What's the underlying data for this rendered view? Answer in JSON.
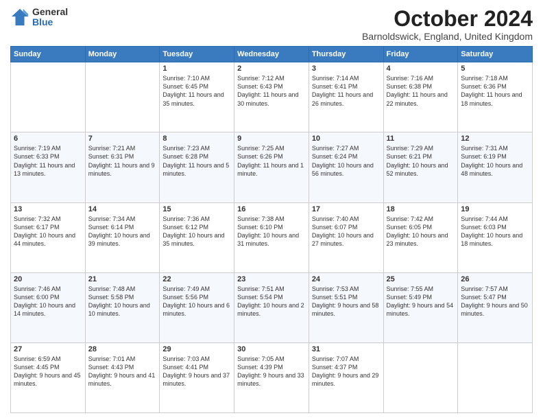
{
  "logo": {
    "general": "General",
    "blue": "Blue"
  },
  "header": {
    "month": "October 2024",
    "location": "Barnoldswick, England, United Kingdom"
  },
  "days": [
    "Sunday",
    "Monday",
    "Tuesday",
    "Wednesday",
    "Thursday",
    "Friday",
    "Saturday"
  ],
  "weeks": [
    [
      {
        "day": "",
        "content": ""
      },
      {
        "day": "",
        "content": ""
      },
      {
        "day": "1",
        "content": "Sunrise: 7:10 AM\nSunset: 6:45 PM\nDaylight: 11 hours and 35 minutes."
      },
      {
        "day": "2",
        "content": "Sunrise: 7:12 AM\nSunset: 6:43 PM\nDaylight: 11 hours and 30 minutes."
      },
      {
        "day": "3",
        "content": "Sunrise: 7:14 AM\nSunset: 6:41 PM\nDaylight: 11 hours and 26 minutes."
      },
      {
        "day": "4",
        "content": "Sunrise: 7:16 AM\nSunset: 6:38 PM\nDaylight: 11 hours and 22 minutes."
      },
      {
        "day": "5",
        "content": "Sunrise: 7:18 AM\nSunset: 6:36 PM\nDaylight: 11 hours and 18 minutes."
      }
    ],
    [
      {
        "day": "6",
        "content": "Sunrise: 7:19 AM\nSunset: 6:33 PM\nDaylight: 11 hours and 13 minutes."
      },
      {
        "day": "7",
        "content": "Sunrise: 7:21 AM\nSunset: 6:31 PM\nDaylight: 11 hours and 9 minutes."
      },
      {
        "day": "8",
        "content": "Sunrise: 7:23 AM\nSunset: 6:28 PM\nDaylight: 11 hours and 5 minutes."
      },
      {
        "day": "9",
        "content": "Sunrise: 7:25 AM\nSunset: 6:26 PM\nDaylight: 11 hours and 1 minute."
      },
      {
        "day": "10",
        "content": "Sunrise: 7:27 AM\nSunset: 6:24 PM\nDaylight: 10 hours and 56 minutes."
      },
      {
        "day": "11",
        "content": "Sunrise: 7:29 AM\nSunset: 6:21 PM\nDaylight: 10 hours and 52 minutes."
      },
      {
        "day": "12",
        "content": "Sunrise: 7:31 AM\nSunset: 6:19 PM\nDaylight: 10 hours and 48 minutes."
      }
    ],
    [
      {
        "day": "13",
        "content": "Sunrise: 7:32 AM\nSunset: 6:17 PM\nDaylight: 10 hours and 44 minutes."
      },
      {
        "day": "14",
        "content": "Sunrise: 7:34 AM\nSunset: 6:14 PM\nDaylight: 10 hours and 39 minutes."
      },
      {
        "day": "15",
        "content": "Sunrise: 7:36 AM\nSunset: 6:12 PM\nDaylight: 10 hours and 35 minutes."
      },
      {
        "day": "16",
        "content": "Sunrise: 7:38 AM\nSunset: 6:10 PM\nDaylight: 10 hours and 31 minutes."
      },
      {
        "day": "17",
        "content": "Sunrise: 7:40 AM\nSunset: 6:07 PM\nDaylight: 10 hours and 27 minutes."
      },
      {
        "day": "18",
        "content": "Sunrise: 7:42 AM\nSunset: 6:05 PM\nDaylight: 10 hours and 23 minutes."
      },
      {
        "day": "19",
        "content": "Sunrise: 7:44 AM\nSunset: 6:03 PM\nDaylight: 10 hours and 18 minutes."
      }
    ],
    [
      {
        "day": "20",
        "content": "Sunrise: 7:46 AM\nSunset: 6:00 PM\nDaylight: 10 hours and 14 minutes."
      },
      {
        "day": "21",
        "content": "Sunrise: 7:48 AM\nSunset: 5:58 PM\nDaylight: 10 hours and 10 minutes."
      },
      {
        "day": "22",
        "content": "Sunrise: 7:49 AM\nSunset: 5:56 PM\nDaylight: 10 hours and 6 minutes."
      },
      {
        "day": "23",
        "content": "Sunrise: 7:51 AM\nSunset: 5:54 PM\nDaylight: 10 hours and 2 minutes."
      },
      {
        "day": "24",
        "content": "Sunrise: 7:53 AM\nSunset: 5:51 PM\nDaylight: 9 hours and 58 minutes."
      },
      {
        "day": "25",
        "content": "Sunrise: 7:55 AM\nSunset: 5:49 PM\nDaylight: 9 hours and 54 minutes."
      },
      {
        "day": "26",
        "content": "Sunrise: 7:57 AM\nSunset: 5:47 PM\nDaylight: 9 hours and 50 minutes."
      }
    ],
    [
      {
        "day": "27",
        "content": "Sunrise: 6:59 AM\nSunset: 4:45 PM\nDaylight: 9 hours and 45 minutes."
      },
      {
        "day": "28",
        "content": "Sunrise: 7:01 AM\nSunset: 4:43 PM\nDaylight: 9 hours and 41 minutes."
      },
      {
        "day": "29",
        "content": "Sunrise: 7:03 AM\nSunset: 4:41 PM\nDaylight: 9 hours and 37 minutes."
      },
      {
        "day": "30",
        "content": "Sunrise: 7:05 AM\nSunset: 4:39 PM\nDaylight: 9 hours and 33 minutes."
      },
      {
        "day": "31",
        "content": "Sunrise: 7:07 AM\nSunset: 4:37 PM\nDaylight: 9 hours and 29 minutes."
      },
      {
        "day": "",
        "content": ""
      },
      {
        "day": "",
        "content": ""
      }
    ]
  ]
}
